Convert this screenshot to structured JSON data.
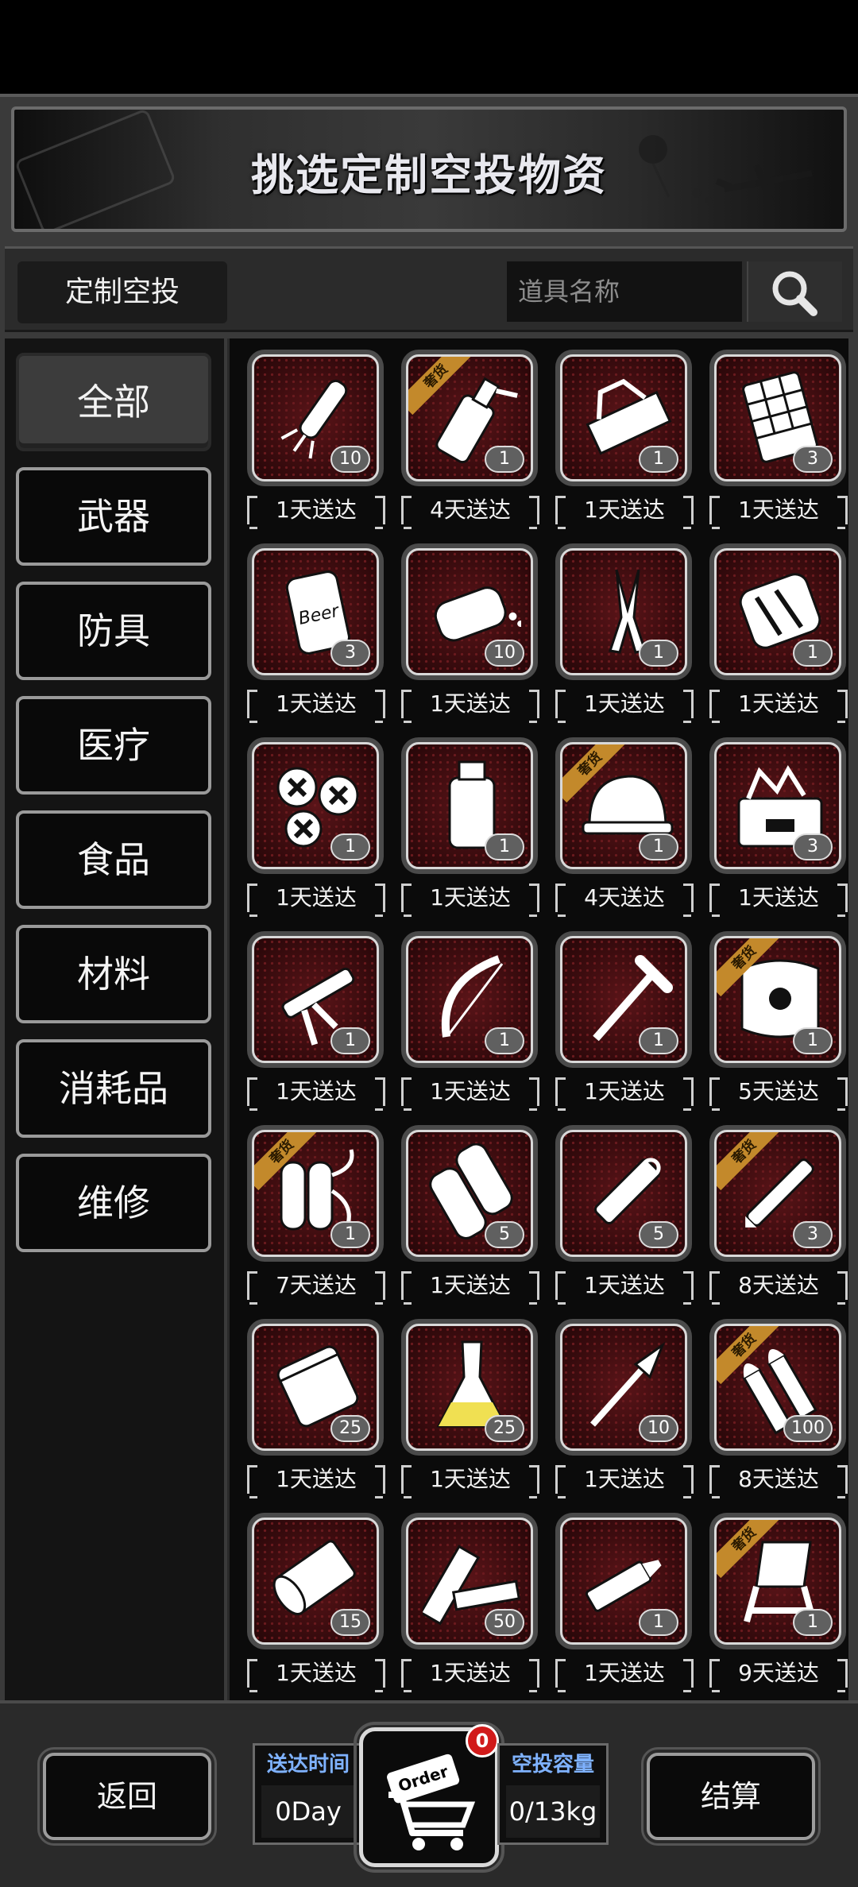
{
  "banner": {
    "title": "挑选定制空投物资"
  },
  "filter": {
    "custom_tab_label": "定制空投",
    "search_placeholder": "道具名称"
  },
  "sidebar": {
    "items": [
      {
        "label": "全部",
        "active": true
      },
      {
        "label": "武器"
      },
      {
        "label": "防具"
      },
      {
        "label": "医疗"
      },
      {
        "label": "食品"
      },
      {
        "label": "材料"
      },
      {
        "label": "消耗品"
      },
      {
        "label": "维修"
      }
    ]
  },
  "tag_label": "奢货",
  "items": [
    {
      "icon": "flashlight-icon",
      "count": "10",
      "delivery": "1天送达",
      "tag": false
    },
    {
      "icon": "spray-bottle-icon",
      "count": "1",
      "delivery": "4天送达",
      "tag": true
    },
    {
      "icon": "toolbox-tray-icon",
      "count": "1",
      "delivery": "1天送达",
      "tag": false
    },
    {
      "icon": "chocolate-bar-icon",
      "count": "3",
      "delivery": "1天送达",
      "tag": false
    },
    {
      "icon": "beer-can-icon",
      "count": "3",
      "delivery": "1天送达",
      "tag": false
    },
    {
      "icon": "bread-icon",
      "count": "10",
      "delivery": "1天送达",
      "tag": false
    },
    {
      "icon": "wire-cutter-icon",
      "count": "1",
      "delivery": "1天送达",
      "tag": false
    },
    {
      "icon": "tool-case-icon",
      "count": "1",
      "delivery": "1天送达",
      "tag": false
    },
    {
      "icon": "screws-icon",
      "count": "1",
      "delivery": "1天送达",
      "tag": false
    },
    {
      "icon": "bottle-icon",
      "count": "1",
      "delivery": "1天送达",
      "tag": false
    },
    {
      "icon": "hard-hat-icon",
      "count": "1",
      "delivery": "4天送达",
      "tag": true
    },
    {
      "icon": "toolbox-icon",
      "count": "3",
      "delivery": "1天送达",
      "tag": false
    },
    {
      "icon": "caulk-gun-icon",
      "count": "1",
      "delivery": "1天送达",
      "tag": false
    },
    {
      "icon": "bow-saw-icon",
      "count": "1",
      "delivery": "1天送达",
      "tag": false
    },
    {
      "icon": "pickaxe-icon",
      "count": "1",
      "delivery": "1天送达",
      "tag": false
    },
    {
      "icon": "shield-icon",
      "count": "1",
      "delivery": "5天送达",
      "tag": true
    },
    {
      "icon": "oxygen-tank-icon",
      "count": "1",
      "delivery": "7天送达",
      "tag": true
    },
    {
      "icon": "cloth-roll-icon",
      "count": "5",
      "delivery": "1天送达",
      "tag": false
    },
    {
      "icon": "utility-knife-icon",
      "count": "5",
      "delivery": "1天送达",
      "tag": false
    },
    {
      "icon": "pen-icon",
      "count": "3",
      "delivery": "8天送达",
      "tag": true
    },
    {
      "icon": "bag-icon",
      "count": "25",
      "delivery": "1天送达",
      "tag": false
    },
    {
      "icon": "flask-icon",
      "count": "25",
      "delivery": "1天送达",
      "tag": false
    },
    {
      "icon": "spear-icon",
      "count": "10",
      "delivery": "1天送达",
      "tag": false
    },
    {
      "icon": "bullets-icon",
      "count": "100",
      "delivery": "8天送达",
      "tag": true
    },
    {
      "icon": "paper-roll-icon",
      "count": "15",
      "delivery": "1天送达",
      "tag": false
    },
    {
      "icon": "planks-icon",
      "count": "50",
      "delivery": "1天送达",
      "tag": false
    },
    {
      "icon": "glue-tube-icon",
      "count": "1",
      "delivery": "1天送达",
      "tag": false
    },
    {
      "icon": "folding-chair-icon",
      "count": "1",
      "delivery": "9天送达",
      "tag": true
    }
  ],
  "bottom": {
    "back_label": "返回",
    "checkout_label": "结算",
    "delivery_time_label": "送达时间",
    "delivery_time_value": "0Day",
    "capacity_label": "空投容量",
    "capacity_value": "0/13kg",
    "cart_badge": "0",
    "cart_icon": "order-cart-icon",
    "cart_text": "Order"
  },
  "colors": {
    "slot_red": "#5a1418",
    "tag_gold": "#c3892b",
    "label_blue": "#7fb2ff",
    "badge_red": "#d11a1a"
  }
}
